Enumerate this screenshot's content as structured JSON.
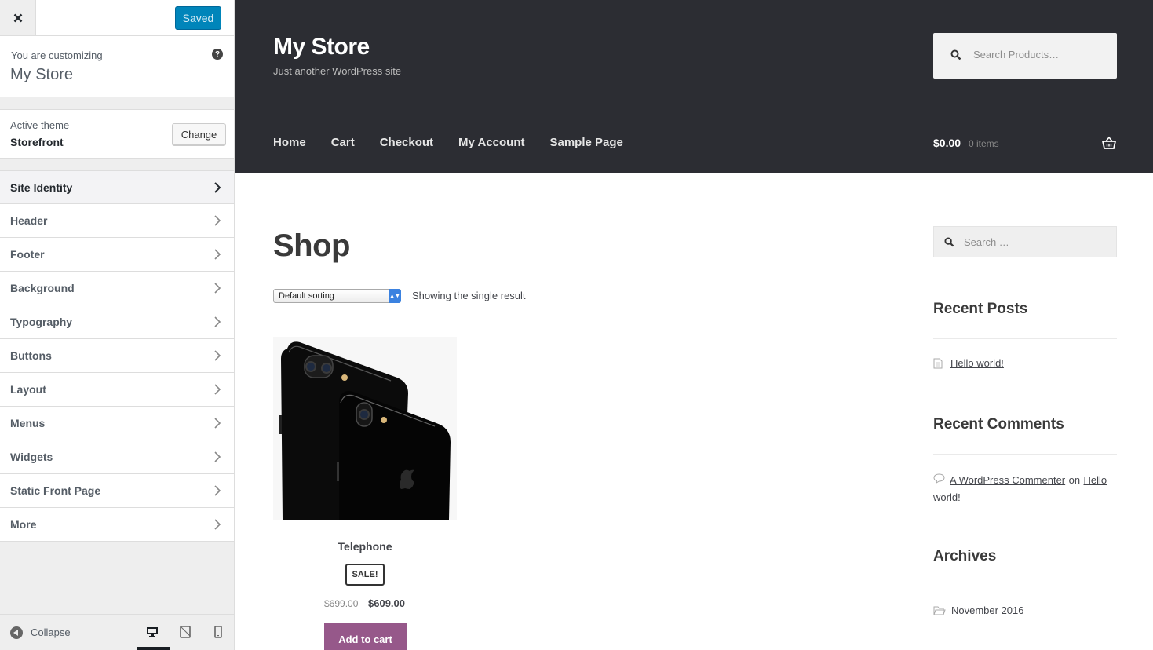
{
  "customizer": {
    "saved_label": "Saved",
    "info": {
      "lead": "You are customizing",
      "site_name": "My Store"
    },
    "theme": {
      "label": "Active theme",
      "name": "Storefront",
      "change_label": "Change"
    },
    "panels": [
      "Site Identity",
      "Header",
      "Footer",
      "Background",
      "Typography",
      "Buttons",
      "Layout",
      "Menus",
      "Widgets",
      "Static Front Page",
      "More"
    ],
    "footer": {
      "collapse_label": "Collapse"
    },
    "icons": [
      "close-icon",
      "help-icon",
      "chevron-right-icon",
      "collapse-icon",
      "desktop-icon",
      "tablet-icon",
      "mobile-icon"
    ]
  },
  "site": {
    "title": "My Store",
    "description": "Just another WordPress site",
    "search_placeholder": "Search Products…",
    "nav": [
      "Home",
      "Cart",
      "Checkout",
      "My Account",
      "Sample Page"
    ],
    "cart_total": "$0.00",
    "cart_count": "0 items"
  },
  "shop": {
    "title": "Shop",
    "sort_selected": "Default sorting",
    "result_count": "Showing the single result",
    "product": {
      "name": "Telephone",
      "badge": "SALE!",
      "price_old": "$699.00",
      "price_new": "$609.00",
      "add_to_cart": "Add to cart"
    }
  },
  "sidebar_widgets": {
    "search_placeholder": "Search …",
    "recent_posts_title": "Recent Posts",
    "recent_post": "Hello world!",
    "recent_comments_title": "Recent Comments",
    "comment_author": "A WordPress Commenter",
    "comment_on": "on",
    "comment_post_a": "Hello",
    "comment_post_b": "world!",
    "archives_title": "Archives",
    "archive_month": "November 2016"
  },
  "colors": {
    "header_bg": "#2c2d33",
    "accent_button": "#96588a",
    "saved_button": "#0085ba"
  }
}
